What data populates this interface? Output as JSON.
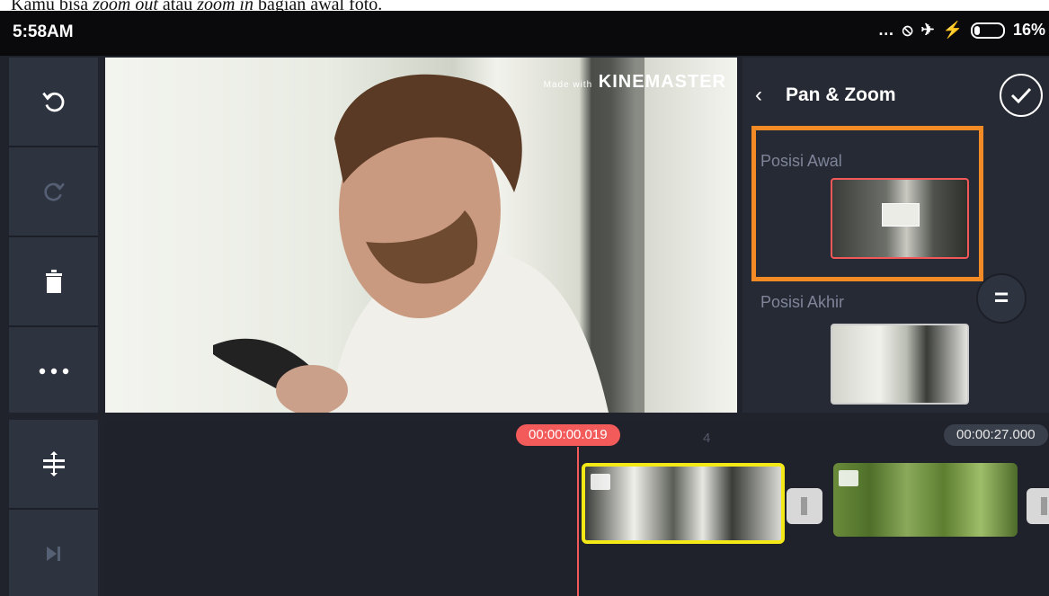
{
  "caption": {
    "pre": "Kamu bisa ",
    "zoom_out": "zoom out",
    "mid": " atau ",
    "zoom_in": "zoom in",
    "post": " bagian awal foto."
  },
  "status": {
    "time": "5:58AM",
    "battery": "16%"
  },
  "preview": {
    "watermark_small": "Made with",
    "watermark": "KINEMASTER"
  },
  "panel": {
    "title": "Pan & Zoom",
    "start_label": "Posisi Awal",
    "end_label": "Posisi Akhir"
  },
  "timeline": {
    "current_time": "00:00:00.019",
    "total_time": "00:00:27.000",
    "ruler_mark": "4"
  },
  "colors": {
    "accent": "#f28a26",
    "playhead": "#f35a5a",
    "selected_clip": "#f4e816"
  }
}
